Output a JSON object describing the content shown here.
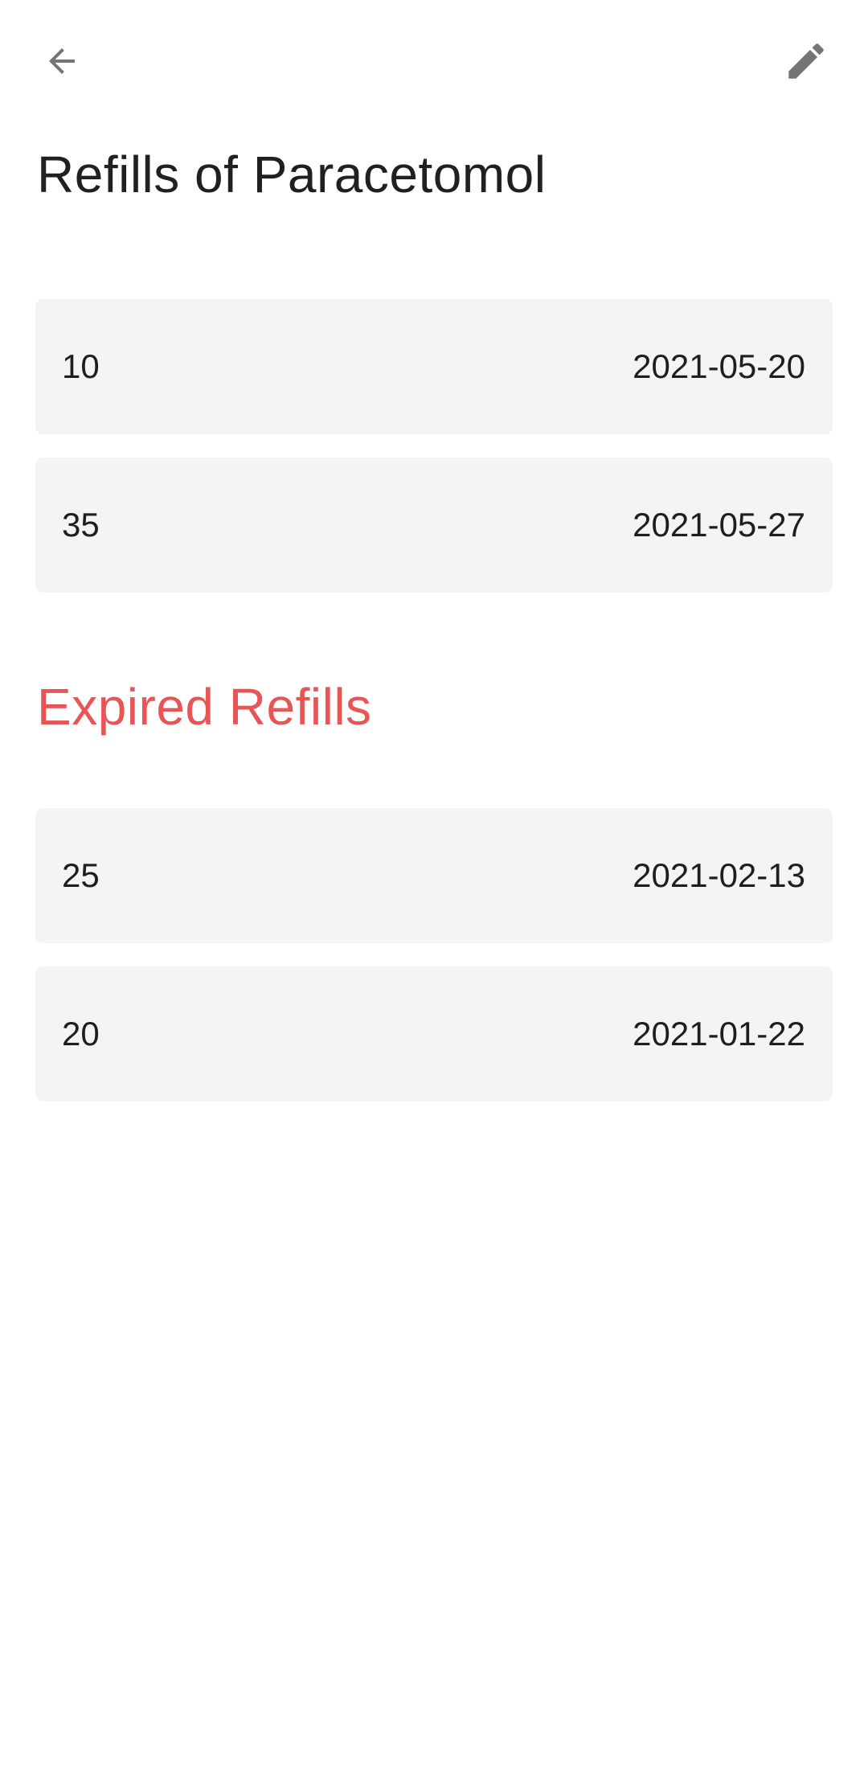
{
  "header": {
    "back_icon": "arrow-back-icon",
    "edit_icon": "pencil-edit-icon",
    "icon_color": "#757575"
  },
  "page": {
    "title": "Refills of Paracetomol"
  },
  "refills": [
    {
      "amount": "10",
      "date": "2021-05-20"
    },
    {
      "amount": "35",
      "date": "2021-05-27"
    }
  ],
  "expired": {
    "title": "Expired Refills",
    "title_color": "#e85555",
    "items": [
      {
        "amount": "25",
        "date": "2021-02-13"
      },
      {
        "amount": "20",
        "date": "2021-01-22"
      }
    ]
  },
  "colors": {
    "card_background": "#f4f4f4",
    "text": "#1e1e1e"
  }
}
